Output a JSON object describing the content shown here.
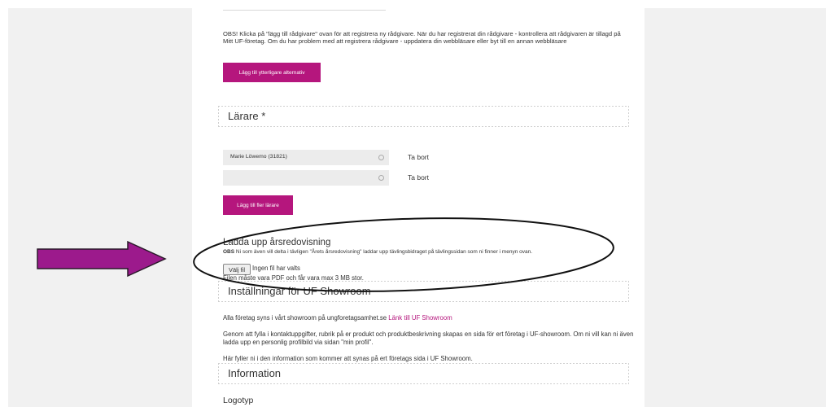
{
  "note": "OBS! Klicka på \"lägg till rådgivare\" ovan för att registrera ny rådgivare. När du har registrerat din rådgivare - kontrollera att rådgivaren är tillagd på Mitt UF-företag. Om du har problem med att registrera rådgivare - uppdatera din webbläsare eller byt till en annan webbläsare",
  "add_alternative_button": "Lägg till ytterligare alternativ",
  "teachers_section": "Lärare *",
  "teachers": [
    {
      "value": "Marie Löwemo (31821)",
      "remove_label": "Ta bort"
    },
    {
      "value": "",
      "remove_label": "Ta bort"
    }
  ],
  "add_teacher_button": "Lägg till fler lärare",
  "upload": {
    "title": "Ladda upp årsredovisning",
    "note_bold": "OBS",
    "note": " Ni som även vill delta i tävligen \"Årets årsredovisning\" laddar upp tävlingsbidraget på tävlingssidan som ni finner i menyn ovan.",
    "file_button": "Välj fil",
    "file_status": "Ingen fil har valts",
    "hint": "Filen måste vara PDF och får vara max 3 MB stor."
  },
  "showroom_section": "Inställningar för UF Showroom",
  "showroom_text": "Alla företag syns i vårt showroom på ungforetagsamhet.se",
  "showroom_link": "Länk till UF Showroom",
  "showroom_info": "Genom att fylla i kontaktuppgifter, rubrik på er produkt och produktbeskrivning skapas en sida för ert företag i UF-showroom. Om ni vill kan ni även ladda upp en personlig profilbild via sidan \"min profil\".",
  "showroom_fill": "Här fyller ni i den information som kommer att synas på ert företags sida i UF Showroom.",
  "info_section": "Information",
  "logotyp_label": "Logotyp",
  "colors": {
    "accent": "#b5167d",
    "arrow": "#9c1a8c"
  }
}
